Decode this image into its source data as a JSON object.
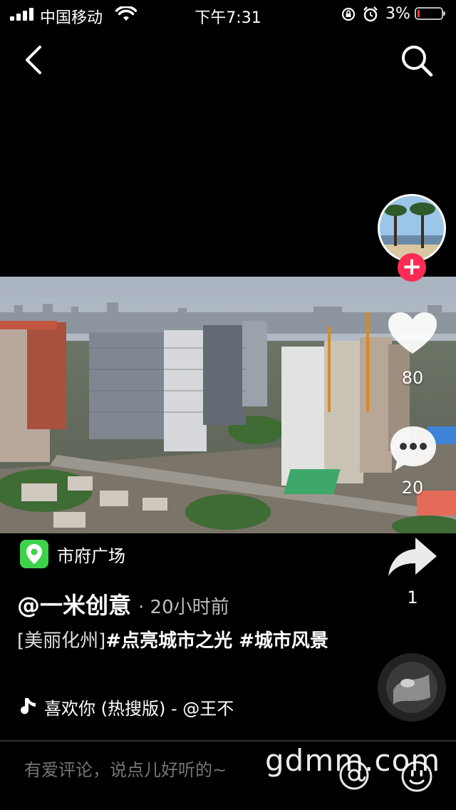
{
  "status_bar": {
    "carrier": "中国移动",
    "time": "下午7:31",
    "battery_percent": "3%"
  },
  "video": {
    "scene": "aerial-city-skyline"
  },
  "creator": {
    "follow_symbol": "+"
  },
  "actions": {
    "like_count": "80",
    "comment_count": "20",
    "share_count": "1"
  },
  "location": {
    "label": "市府广场"
  },
  "post": {
    "author": "@一米创意",
    "time": "· 20小时前",
    "caption_bracket": "[美丽化州]",
    "caption_tags": "#点亮城市之光 #城市风景"
  },
  "music": {
    "title": "喜欢你 (热搜版) - @王不"
  },
  "comment_bar": {
    "placeholder": "有爱评论，说点儿好听的~"
  },
  "watermark": {
    "text": "gdmm.com"
  },
  "colors": {
    "accent": "#fe2c55",
    "location_green": "#3cd34b",
    "background": "#000000"
  }
}
